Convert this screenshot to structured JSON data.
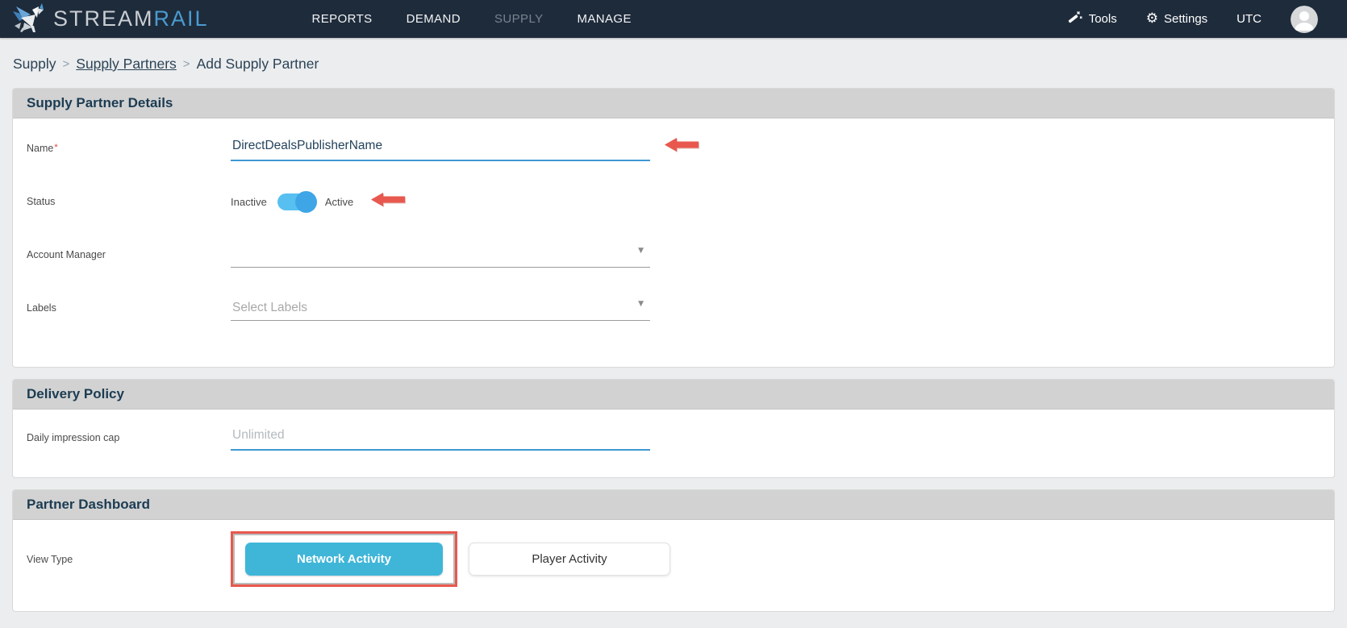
{
  "navbar": {
    "brand": {
      "stream": "STREAM",
      "rail": "RAIL"
    },
    "items": [
      {
        "label": "REPORTS",
        "active": false
      },
      {
        "label": "DEMAND",
        "active": false
      },
      {
        "label": "SUPPLY",
        "active": true
      },
      {
        "label": "MANAGE",
        "active": false
      }
    ],
    "tools_label": "Tools",
    "settings_label": "Settings",
    "timezone": "UTC"
  },
  "breadcrumb": {
    "items": [
      "Supply",
      "Supply Partners",
      "Add Supply Partner"
    ],
    "separator": ">"
  },
  "sections": {
    "details": {
      "title": "Supply Partner Details",
      "fields": {
        "name": {
          "label": "Name",
          "required_mark": "*",
          "value": "DirectDealsPublisherName"
        },
        "status": {
          "label": "Status",
          "inactive_label": "Inactive",
          "active_label": "Active",
          "state": "active"
        },
        "account_manager": {
          "label": "Account Manager",
          "value": ""
        },
        "labels": {
          "label": "Labels",
          "placeholder": "Select Labels"
        }
      }
    },
    "delivery": {
      "title": "Delivery Policy",
      "fields": {
        "daily_cap": {
          "label": "Daily impression cap",
          "placeholder": "Unlimited"
        }
      }
    },
    "dashboard": {
      "title": "Partner Dashboard",
      "view_type": {
        "label": "View Type",
        "options": [
          {
            "label": "Network Activity",
            "selected": true
          },
          {
            "label": "Player Activity",
            "selected": false
          }
        ]
      }
    }
  },
  "icons": {
    "chevron_down_glyph": "▼",
    "gear_glyph": "⚙"
  },
  "colors": {
    "navbar_bg": "#1e2b3b",
    "brand_blue": "#4a9bd1",
    "accent_blue": "#3f97d3",
    "toggle_track_blue": "#58c0f0",
    "toggle_knob_blue": "#3ea6e6",
    "button_teal": "#3fb6d8",
    "annotation_red": "#e8584e",
    "section_header_gray": "#d2d2d2"
  }
}
